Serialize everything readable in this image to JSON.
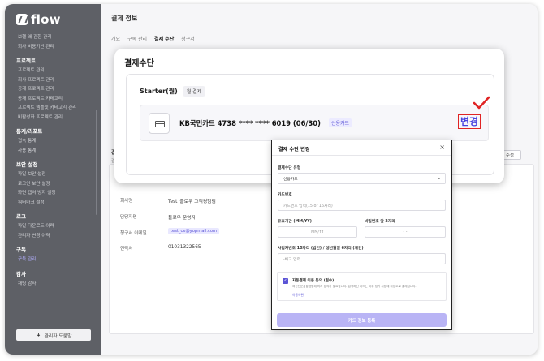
{
  "app": {
    "logo_text": "flow"
  },
  "sidebar": {
    "top_items": [
      "보헬 왜 관한 관리",
      "회사 비용기반 관리"
    ],
    "sections": [
      {
        "heading": "프로젝트",
        "items": [
          "프로젝트 관리",
          "회사 프로젝트 관리",
          "공개 프로젝트 관리",
          "공개 프로젝트 카테고리",
          "프로젝트 템플릿 카테고리 관리",
          "비활성화 프로젝트 관리"
        ]
      },
      {
        "heading": "통계/리포트",
        "items": [
          "접속 통계",
          "사용 통계"
        ]
      },
      {
        "heading": "보안 설정",
        "items": [
          "파일 보안 설정",
          "로그인 보안 설정",
          "화면 캡처 방지 설정",
          "워터마크 설정"
        ]
      },
      {
        "heading": "로그",
        "items": [
          "파일 다운로드 이력",
          "관리자 변경 이력"
        ]
      },
      {
        "heading": "구독",
        "items": [
          "구독 관리"
        ]
      },
      {
        "heading": "감사",
        "items": [
          "채팅 감사"
        ]
      }
    ],
    "help_button": "관리자 도움말"
  },
  "main": {
    "title": "결제 정보",
    "tabs": [
      "개요",
      "구독 관리",
      "결제 수단",
      "청구서"
    ],
    "active_tab": "결제 수단",
    "edit_button": "수정",
    "bg_label_1": "결제",
    "bg_label_2": "결제",
    "info": [
      {
        "label": "회사명",
        "value": "Test_플로우 고객경험팀"
      },
      {
        "label": "담당자명",
        "value": "플로우 운영자"
      },
      {
        "label": "청구서 이메일",
        "value": "test_cx@yopmail.com"
      },
      {
        "label": "연락처",
        "value": "01031322565"
      }
    ]
  },
  "payment_panel": {
    "title": "결제수단",
    "plan_name": "Starter(월)",
    "plan_badge": "월 결제",
    "card_number": "KB국민카드 4738 **** **** 6019 (06/30)",
    "card_type": "신용카드",
    "change_label": "변경"
  },
  "modal": {
    "title": "결제 수단 변경",
    "close": "×",
    "method_label": "결제수단 유형",
    "method_value": "신용카드",
    "card_label": "카드번호",
    "card_placeholder": "카드번호 입력(15 or 16자리)",
    "expiry_label": "유효기간 (MM/YY)",
    "expiry_placeholder": "MM/YY",
    "pw_label": "비밀번호 앞 2자리",
    "pw_placeholder": "- -",
    "biz_label": "사업자번호 10자리 (법인) / 생년월일 6자리 (개인)",
    "biz_placeholder": "-빼고 입력",
    "agree_title": "자동결제 이용 동의 (필수)",
    "agree_desc": "여신전문금융업법에 따라 동의가 필요합니다. 입력하신 카드는 이후 정기 사용에 자동으로 결제됩니다.",
    "agree_link": "이용약관",
    "submit": "카드 정보 등록"
  },
  "colors": {
    "accent": "#5b54d6",
    "sidebar_bg": "#5e6066",
    "highlight_red": "#e02424"
  }
}
